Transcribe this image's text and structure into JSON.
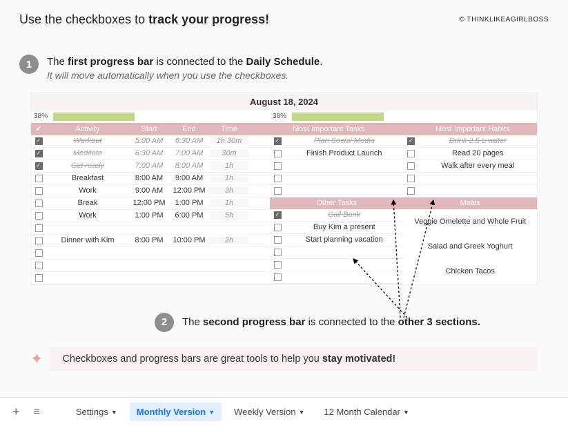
{
  "header": {
    "intro": "Use the checkboxes to ",
    "introBold": "track your progress!",
    "copyright": "© THINKLIKEAGIRLBOSS"
  },
  "step1": {
    "num": "1",
    "a": "The ",
    "b": "first progress bar",
    "c": " is connected to the ",
    "d": "Daily Schedule",
    "e": ".",
    "sub": "It will move automatically when you use the checkboxes."
  },
  "step2": {
    "num": "2",
    "a": "The ",
    "b": "second progress bar",
    "c": " is connected to the ",
    "d": "other 3 sections."
  },
  "planner": {
    "date": "August 18, 2024",
    "pct1": "38%",
    "fill1": 38,
    "pct2": "38%",
    "fill2": 38,
    "headers": {
      "check": "✔",
      "activity": "Activity",
      "start": "Start",
      "end": "End",
      "time": "Time",
      "tasks": "Most Important Tasks",
      "habits": "Most Important Habits",
      "other": "Other Tasks",
      "meals": "Meals"
    },
    "schedule": [
      {
        "done": true,
        "act": "Workout",
        "start": "5:00 AM",
        "end": "6:30 AM",
        "time": "1h 30m"
      },
      {
        "done": true,
        "act": "Meditate",
        "start": "6:30 AM",
        "end": "7:00 AM",
        "time": "30m"
      },
      {
        "done": true,
        "act": "Get ready",
        "start": "7:00 AM",
        "end": "8:00 AM",
        "time": "1h"
      },
      {
        "done": false,
        "act": "Breakfast",
        "start": "8:00 AM",
        "end": "9:00 AM",
        "time": "1h"
      },
      {
        "done": false,
        "act": "Work",
        "start": "9:00 AM",
        "end": "12:00 PM",
        "time": "3h"
      },
      {
        "done": false,
        "act": "Break",
        "start": "12:00 PM",
        "end": "1:00 PM",
        "time": "1h"
      },
      {
        "done": false,
        "act": "Work",
        "start": "1:00 PM",
        "end": "6:00 PM",
        "time": "5h"
      },
      {
        "done": false,
        "act": "",
        "start": "",
        "end": "",
        "time": ""
      },
      {
        "done": false,
        "act": "Dinner with Kim",
        "start": "8:00 PM",
        "end": "10:00 PM",
        "time": "2h"
      },
      {
        "done": false,
        "act": "",
        "start": "",
        "end": "",
        "time": ""
      },
      {
        "done": false,
        "act": "",
        "start": "",
        "end": "",
        "time": ""
      },
      {
        "done": false,
        "act": "",
        "start": "",
        "end": "",
        "time": ""
      }
    ],
    "tasks": [
      {
        "done": true,
        "txt": "Plan Social Media"
      },
      {
        "done": false,
        "txt": "Finish Product Launch"
      },
      {
        "done": false,
        "txt": ""
      },
      {
        "done": false,
        "txt": ""
      },
      {
        "done": false,
        "txt": ""
      }
    ],
    "habits": [
      {
        "done": true,
        "txt": "Drink 2.5 L water"
      },
      {
        "done": false,
        "txt": "Read 20 pages"
      },
      {
        "done": false,
        "txt": "Walk after every meal"
      },
      {
        "done": false,
        "txt": ""
      },
      {
        "done": false,
        "txt": ""
      }
    ],
    "other": [
      {
        "done": true,
        "txt": "Call Bank"
      },
      {
        "done": false,
        "txt": "Buy Kim a present"
      },
      {
        "done": false,
        "txt": "Start planning vacation"
      },
      {
        "done": false,
        "txt": ""
      },
      {
        "done": false,
        "txt": ""
      },
      {
        "done": false,
        "txt": ""
      }
    ],
    "meals": [
      "Veggie Omelette and Whole Fruit",
      "Salad and Greek Yoghurt",
      "Chicken Tacos"
    ]
  },
  "footer": {
    "note_a": "Checkboxes and progress bars are great tools to help you ",
    "note_b": "stay motivated!"
  },
  "tabs": {
    "settings": "Settings",
    "monthly": "Monthly Version",
    "weekly": "Weekly Version",
    "cal": "12 Month Calendar"
  }
}
